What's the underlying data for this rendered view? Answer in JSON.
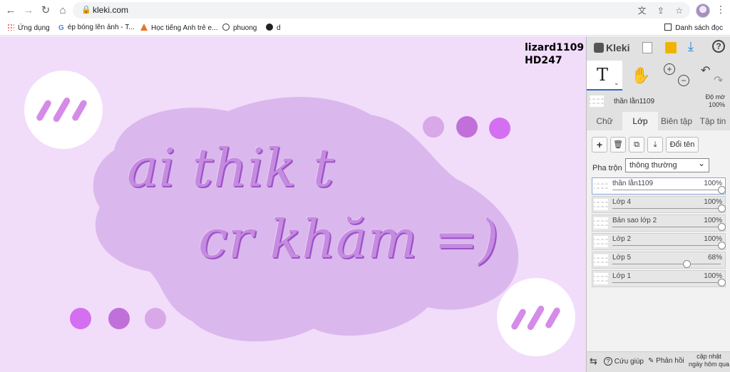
{
  "browser": {
    "url": "kleki.com",
    "bookmarks": [
      {
        "label": "Ứng dụng",
        "icon": "apps-grid-icon"
      },
      {
        "label": "ép bóng lên ảnh - T...",
        "icon": "google-icon"
      },
      {
        "label": "Học tiếng Anh trẻ e...",
        "icon": "triangle-logo-icon"
      },
      {
        "label": "phuong",
        "icon": "timer-icon"
      },
      {
        "label": "d",
        "icon": "globe-icon"
      }
    ],
    "reading_list": "Danh sách đọc"
  },
  "canvas": {
    "watermark_line1": "lizard1109",
    "watermark_line2": "HD247",
    "text_line1": "ai thik t",
    "text_line2": "cr khăm =)",
    "colors": {
      "background": "#f1dcfa",
      "cloud": "#dab7ec",
      "dot_light": "#d8a8e8",
      "dot_mid": "#c070d8",
      "dot_dark": "#d36ff0"
    }
  },
  "panel": {
    "logo": "Kleki",
    "current_layer_name": "thần lằn1109",
    "opacity_label": "Độ mờ",
    "opacity_value": "100%",
    "tabs": [
      "Chữ",
      "Lớp",
      "Biên tập",
      "Tập tin"
    ],
    "active_tab": "Lớp",
    "rename_button": "Đổi tên",
    "blend_label": "Pha trộn",
    "blend_value": "thông thường",
    "layers": [
      {
        "name": "thần lằn1109",
        "opacity": "100%",
        "level": 1.0
      },
      {
        "name": "Lớp 4",
        "opacity": "100%",
        "level": 1.0
      },
      {
        "name": "Bản sao lớp 2",
        "opacity": "100%",
        "level": 1.0
      },
      {
        "name": "Lớp 2",
        "opacity": "100%",
        "level": 1.0
      },
      {
        "name": "Lớp 5",
        "opacity": "68%",
        "level": 0.68
      },
      {
        "name": "Lớp 1",
        "opacity": "100%",
        "level": 1.0
      }
    ],
    "bottom": {
      "help": "Cứu giúp",
      "feedback": "Phản hồi",
      "update_line1": "cập nhật",
      "update_line2": "ngày hôm qua"
    }
  }
}
